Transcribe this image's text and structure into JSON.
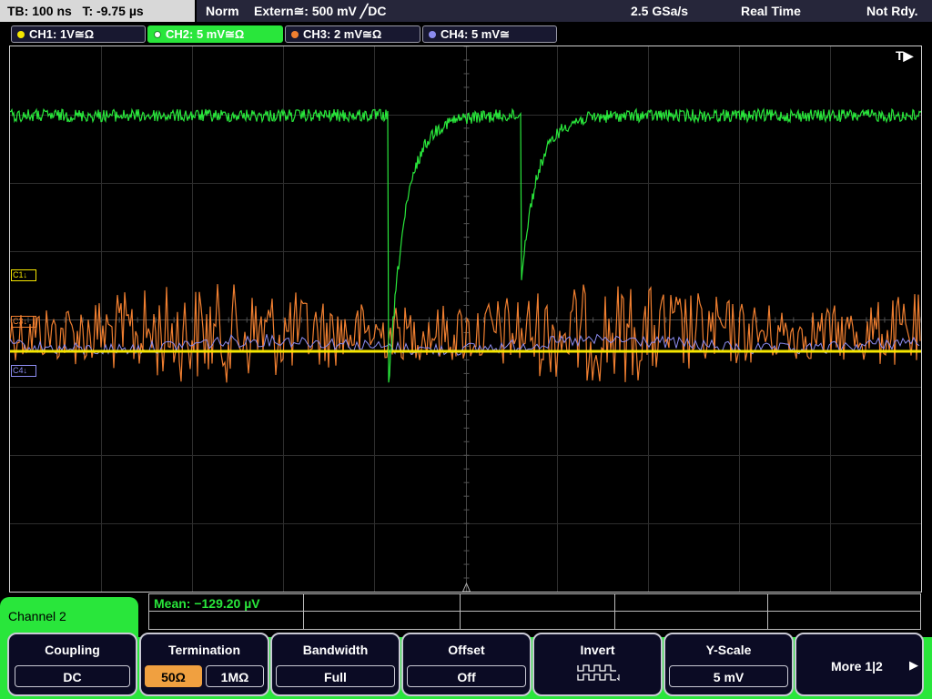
{
  "timebase": {
    "tb": "TB: 100 ns",
    "t": "T: -9.75 µs"
  },
  "status": {
    "mode": "Norm",
    "trigger": "Extern≅: 500 mV ╱DC",
    "sample_rate": "2.5 GSa/s",
    "acquisition": "Real Time",
    "state": "Not Rdy."
  },
  "channels": [
    {
      "label": "CH1: 1V≅Ω",
      "color": "#f5e600"
    },
    {
      "label": "CH2: 5 mV≅Ω",
      "color": "#29e63b"
    },
    {
      "label": "CH3: 2 mV≅Ω",
      "color": "#f07f30"
    },
    {
      "label": "CH4: 5 mV≅",
      "color": "#8c8cf0"
    }
  ],
  "trigger_marker": "T▶",
  "markers": {
    "c1": "C1↓",
    "c3": "C3↓",
    "c4": "C4↓"
  },
  "panel": {
    "label": "Channel 2"
  },
  "measurement": {
    "mean": "Mean: −129.20 µV"
  },
  "softkeys": {
    "coupling": {
      "title": "Coupling",
      "value": "DC"
    },
    "termination": {
      "title": "Termination",
      "opt1": "50Ω",
      "opt2": "1MΩ"
    },
    "bandwidth": {
      "title": "Bandwidth",
      "value": "Full"
    },
    "offset": {
      "title": "Offset",
      "value": "Off"
    },
    "invert": {
      "title": "Invert"
    },
    "yscale": {
      "title": "Y-Scale",
      "value": "5 mV"
    },
    "more": {
      "label": "More 1|2",
      "arrow": "▶"
    }
  },
  "colors": {
    "accent": "#29e63b",
    "selected": "#f0a040",
    "background": "#000000"
  }
}
